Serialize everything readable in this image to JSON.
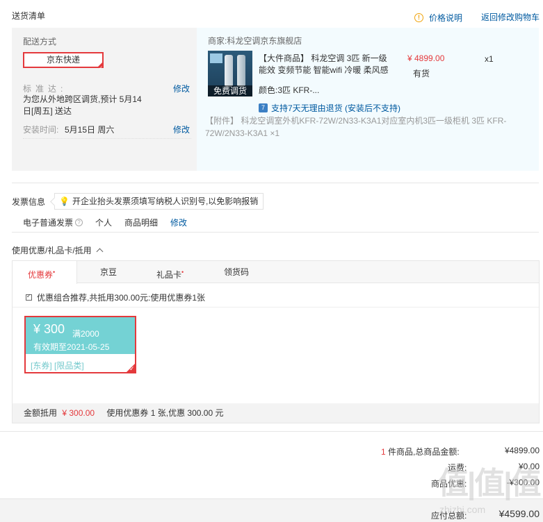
{
  "shipping": {
    "title": "送货清单",
    "price_explain": "价格说明",
    "back_to_cart": "返回修改购物车",
    "delivery_method_label": "配送方式",
    "express_option": "京东快递",
    "standard_label": "标准达:",
    "standard_edit": "修改",
    "standard_text": "为您从外地跨区调货,预计 5月14日[周五] 送达",
    "install_label": "安装时间:",
    "install_date": "5月15日 周六",
    "install_edit": "修改"
  },
  "product": {
    "merchant": "商家:科龙空调京东旗舰店",
    "image_band": "免费调货",
    "name": "【大件商品】 科龙空调 3匹 新一级能效 变频节能 智能wifi 冷暖 柔风感",
    "price": "¥ 4899.00",
    "stock": "有货",
    "quantity": "x1",
    "color": "颜色:3匹 KFR-...",
    "return_icon": "7",
    "return_policy": "支持7天无理由退货 (安装后不支持)",
    "accessory": "【附件】 科龙空调室外机KFR-72W/2N33-K3A1对应室内机3匹一级柜机 3匹 KFR-72W/2N33-K3A1 ×1"
  },
  "invoice": {
    "title": "发票信息",
    "tip": "开企业抬头发票须填写纳税人识别号,以免影响报销",
    "type": "电子普通发票",
    "info_icon": "?",
    "holder": "个人",
    "content": "商品明细",
    "edit": "修改"
  },
  "discount": {
    "title": "使用优惠/礼品卡/抵用",
    "tabs": [
      {
        "label": "优惠券",
        "dot": "•"
      },
      {
        "label": "京豆",
        "dot": ""
      },
      {
        "label": "礼品卡",
        "dot": "•"
      },
      {
        "label": "领货码",
        "dot": ""
      }
    ],
    "combo_text": "优惠组合推荐,共抵用300.00元:使用优惠券1张",
    "coupon": {
      "amount": "¥ 300",
      "condition": "满2000",
      "expiry": "有效期至2021-05-25",
      "tags": "[东券] [限品类]"
    },
    "summary_label": "金额抵用",
    "summary_amount": "¥ 300.00",
    "summary_detail": "使用优惠券 1 张,优惠 300.00 元"
  },
  "totals": {
    "count": "1",
    "count_text": "件商品,总商品金额:",
    "goods_total": "¥4899.00",
    "shipping_label": "运费:",
    "shipping_value": "¥0.00",
    "discount_label": "商品优惠:",
    "discount_value": "-¥300.00",
    "payable_label": "应付总额:",
    "payable_value": "¥4599.00"
  },
  "watermark": {
    "big": "值|值|值",
    "small": "zhizhi.com"
  },
  "colors": {
    "accent_red": "#e4393c",
    "link_blue": "#005aa0",
    "coupon_teal": "#74d2d4"
  }
}
